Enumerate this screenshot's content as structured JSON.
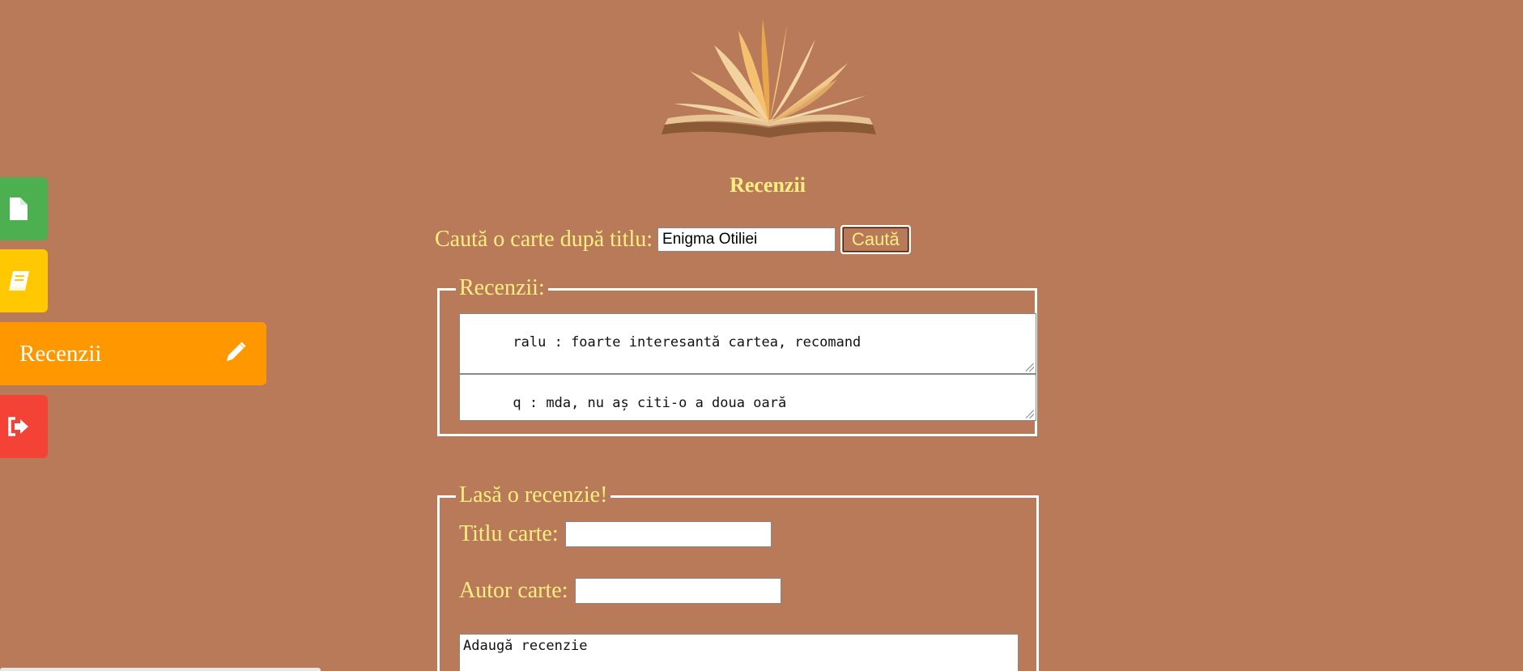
{
  "sidebar": {
    "items": [
      {
        "icon": "file-icon",
        "color": "#4caf50",
        "label": ""
      },
      {
        "icon": "book-icon",
        "color": "#ffc800",
        "label": ""
      },
      {
        "icon": "pencil-icon",
        "color": "#ff9800",
        "label": "Recenzii"
      },
      {
        "icon": "sign-out-icon",
        "color": "#f44336",
        "label": ""
      }
    ]
  },
  "header": {
    "title": "Recenzii"
  },
  "search": {
    "label": "Caută o carte după titlu:",
    "value": "Enigma Otiliei",
    "button_label": "Caută"
  },
  "reviews": {
    "legend": "Recenzii:",
    "items": [
      "ralu : foarte interesantă cartea, recomand",
      "q : mda, nu aș citi-o a doua oară"
    ]
  },
  "add_review": {
    "legend": "Lasă o recenzie!",
    "title_label": "Titlu carte:",
    "title_value": "",
    "author_label": "Autor carte:",
    "author_value": "",
    "review_placeholder": "Adaugă recenzie"
  },
  "colors": {
    "background": "#b87a58",
    "text_accent": "#ffee80"
  }
}
